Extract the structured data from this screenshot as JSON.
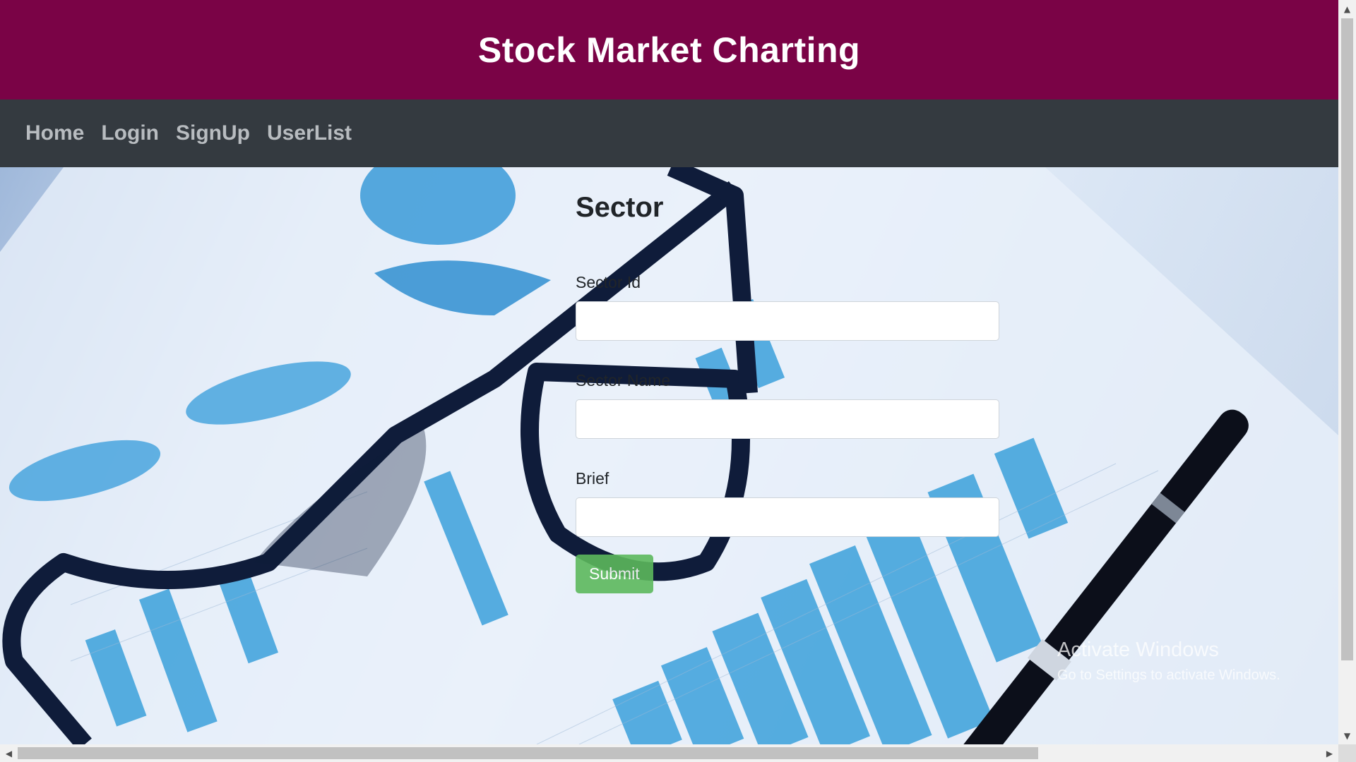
{
  "header": {
    "title": "Stock Market Charting"
  },
  "nav": {
    "items": [
      {
        "label": "Home"
      },
      {
        "label": "Login"
      },
      {
        "label": "SignUp"
      },
      {
        "label": "UserList"
      }
    ]
  },
  "form": {
    "title": "Sector",
    "fields": [
      {
        "label": "Sector Id",
        "value": ""
      },
      {
        "label": "Sector Name",
        "value": ""
      },
      {
        "label": "Brief",
        "value": ""
      }
    ],
    "submit_label": "Submit"
  },
  "watermark": {
    "title": "Activate Windows",
    "subtitle": "Go to Settings to activate Windows."
  },
  "colors": {
    "header_bg": "#7a0346",
    "nav_bg": "#343a40",
    "submit_bg": "#5cb85c"
  }
}
